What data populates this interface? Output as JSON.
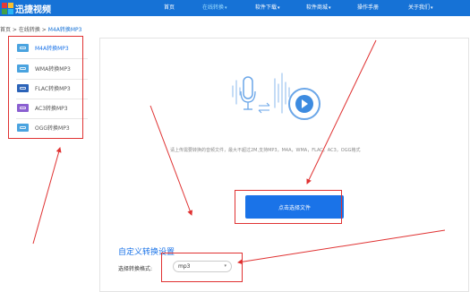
{
  "app": {
    "logo_text": "迅捷视频"
  },
  "nav": {
    "items": [
      {
        "label": "首页",
        "active": false,
        "chevron": false
      },
      {
        "label": "在线转换",
        "active": true,
        "chevron": true
      },
      {
        "label": "软件下载",
        "active": false,
        "chevron": true
      },
      {
        "label": "软件商城",
        "active": false,
        "chevron": true
      },
      {
        "label": "操作手册",
        "active": false,
        "chevron": false
      },
      {
        "label": "关于我们",
        "active": false,
        "chevron": true
      }
    ],
    "chevron_glyph": "▾"
  },
  "breadcrumb": {
    "home": "首页",
    "sep1": " > ",
    "section": "在线转换",
    "sep2": " > ",
    "current": "M4A转换MP3"
  },
  "sidebar": {
    "items": [
      {
        "label": "M4A转换MP3",
        "active": true,
        "icon_color": "#4aa3df"
      },
      {
        "label": "WMA转换MP3",
        "active": false,
        "icon_color": "#4aa3df"
      },
      {
        "label": "FLAC转换MP3",
        "active": false,
        "icon_color": "#2b63b8"
      },
      {
        "label": "AC3转换MP3",
        "active": false,
        "icon_color": "#8a5fd1"
      },
      {
        "label": "OGG转换MP3",
        "active": false,
        "icon_color": "#4aa3df"
      }
    ]
  },
  "upload": {
    "hint": "请上传需要转换的音频文件，最大不超过2M,支持MP3，M4A，WMA，FLAC，AC3，OGG格式",
    "button_label": "点击选择文件"
  },
  "settings": {
    "title": "自定义转换设置",
    "format_label": "选择转换格式:",
    "format_value": "mp3",
    "chevron_glyph": "▾"
  },
  "colors": {
    "nav_bg": "#1672d6",
    "accent": "#1a73e8",
    "annotation_red": "#e03232",
    "illustration": "#6aa6e8"
  }
}
